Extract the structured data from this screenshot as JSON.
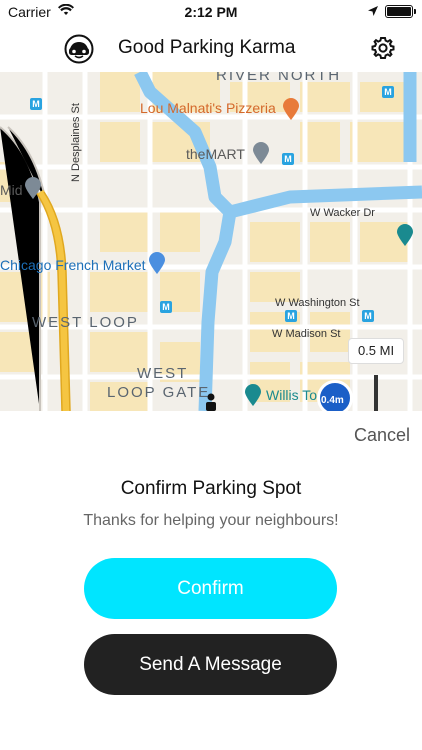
{
  "status_bar": {
    "carrier": "Carrier",
    "time": "2:12 PM",
    "icons": [
      "wifi-icon",
      "location-icon",
      "battery-icon"
    ]
  },
  "nav": {
    "title": "Good Parking Karma",
    "logo_icon": "car-face-icon",
    "settings_icon": "gear-icon"
  },
  "map": {
    "labels": {
      "river_north": "RIVER NORTH",
      "lou_malnatis": "Lou Malnati's Pizzeria",
      "the_mart": "theMART",
      "n_desplaines": "N Desplaines St",
      "mid": "Mid",
      "w_wacker": "W Wacker Dr",
      "chicago_french_market": "Chicago French Market",
      "west_loop": "WEST LOOP",
      "w_washington": "W Washington St",
      "w_madison": "W Madison St",
      "west_loop_gate_1": "WEST",
      "west_loop_gate_2": "LOOP GATE",
      "willis_tower": "Willis To"
    },
    "scale": "0.5 MI",
    "user_marker_label": "0.4m",
    "colors": {
      "land": "#f2efe9",
      "block": "#f7e6b8",
      "water": "#8cc8f0",
      "highway": "#f5c542",
      "road": "#ffffff",
      "transit": "#29a3e0"
    }
  },
  "sheet": {
    "cancel_label": "Cancel",
    "title": "Confirm Parking Spot",
    "subtitle": "Thanks for helping your neighbours!",
    "confirm_label": "Confirm",
    "message_label": "Send A Message",
    "colors": {
      "confirm": "#00e5ff",
      "message": "#222222"
    }
  }
}
